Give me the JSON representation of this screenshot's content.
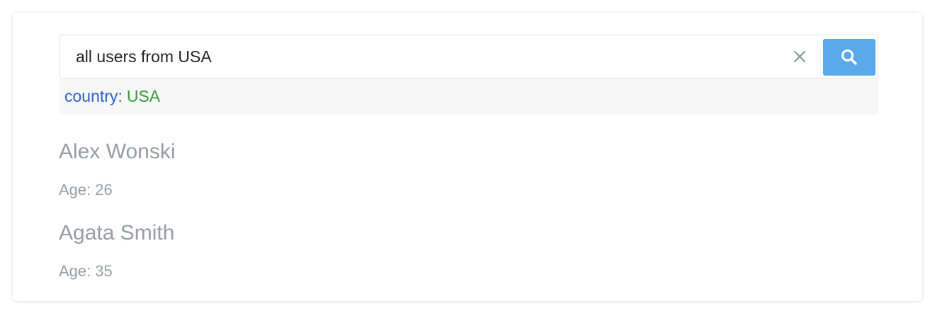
{
  "search": {
    "query": "all users from USA",
    "clear_icon": "close-icon",
    "search_icon": "search-icon",
    "button_color": "#5aa9e9"
  },
  "filter_hint": {
    "key": "country",
    "separator": ":",
    "value": "USA",
    "key_color": "#2f62c8",
    "value_color": "#3a9a3a"
  },
  "results": [
    {
      "name": "Alex Wonski",
      "age_label": "Age:",
      "age": "26"
    },
    {
      "name": "Agata Smith",
      "age_label": "Age:",
      "age": "35"
    }
  ]
}
